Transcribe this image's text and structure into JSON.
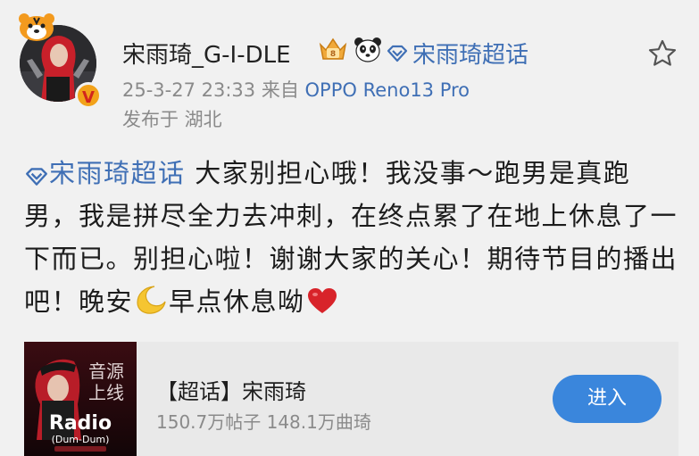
{
  "post": {
    "user_name": "宋雨琦_G-I-DLE",
    "topic_link": "宋雨琦超话",
    "timestamp": "25-3-27 23:33",
    "source_prefix": "来自",
    "device": "OPPO Reno13 Pro",
    "location": "发布于 湖北",
    "body": {
      "topic": "宋雨琦超话",
      "text_part1": " 大家别担心哦！我没事～跑男是真跑男，我是拼尽全力去冲刺，在终点累了在地上休息了一下而已。别担心啦！谢谢大家的关心！期待节目的播出吧！晚安",
      "text_part2": "早点休息呦"
    }
  },
  "card": {
    "thumb_title_line1": "音源",
    "thumb_title_line2": "上线",
    "thumb_radio": "Radio",
    "thumb_sub": "(Dum-Dum)",
    "title": "【超话】宋雨琦",
    "stats": "150.7万帖子 148.1万曲琦",
    "button_label": "进入"
  },
  "colors": {
    "link_blue": "#3f6fb5",
    "button_blue": "#3a86dc",
    "heart_red": "#d8232a",
    "background": "#f1f1f1"
  },
  "icons": [
    "tiger-badge-icon",
    "verified-v-icon",
    "crown-level-icon",
    "panda-icon",
    "diamond-topic-icon",
    "star-icon",
    "moon-emoji-icon",
    "heart-emoji-icon"
  ]
}
